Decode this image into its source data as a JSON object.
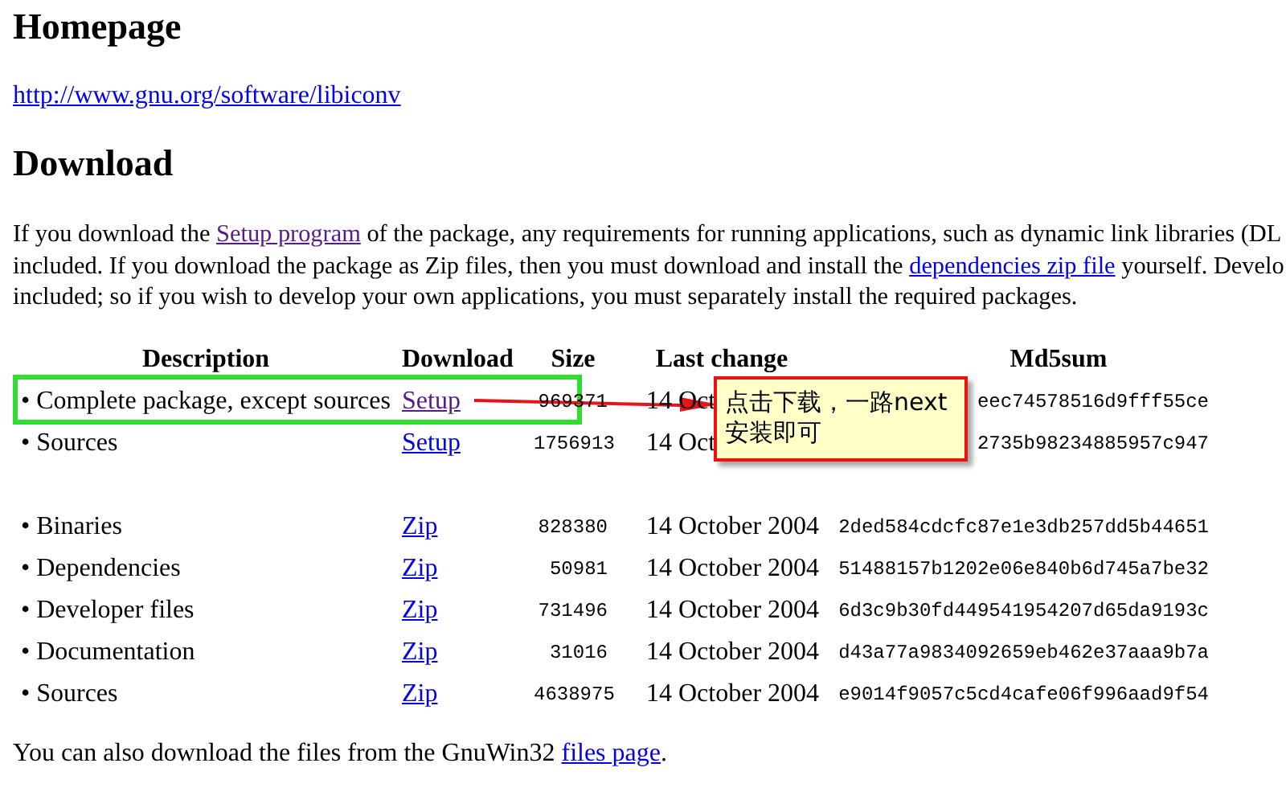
{
  "homepage": {
    "heading": "Homepage",
    "url": "http://www.gnu.org/software/libiconv"
  },
  "download": {
    "heading": "Download",
    "intro": [
      [
        {
          "kind": "text",
          "text": "If you download the "
        },
        {
          "kind": "link",
          "text": "Setup program",
          "visited": true
        },
        {
          "kind": "text",
          "text": " of the package, any requirements for running applications, such as dynamic link libraries (DL"
        }
      ],
      [
        {
          "kind": "text",
          "text": "included. If you download the package as Zip files, then you must download and install the "
        },
        {
          "kind": "link",
          "text": "dependencies zip file",
          "visited": false
        },
        {
          "kind": "text",
          "text": " yourself. Develo"
        }
      ],
      [
        {
          "kind": "text",
          "text": "included; so if you wish to develop your own applications, you must separately install the required packages."
        }
      ]
    ],
    "table": {
      "columns": [
        "Description",
        "Download",
        "Size",
        "Last change",
        "Md5sum"
      ],
      "row_groups": [
        [
          {
            "description": "• Complete package, except sources",
            "link": {
              "text": "Setup",
              "visited": true
            },
            "size": "969371",
            "last_change": "14 Oct",
            "md5sum": "eec74578516d9fff55ce"
          },
          {
            "description": "• Sources",
            "link": {
              "text": "Setup",
              "visited": false
            },
            "size": "1756913",
            "last_change": "14 Oct",
            "md5sum": "2735b98234885957c947"
          }
        ],
        [
          {
            "description": "• Binaries",
            "link": {
              "text": "Zip",
              "visited": false
            },
            "size": "828380",
            "last_change": "14 October 2004",
            "md5sum": "2ded584cdcfc87e1e3db257dd5b44651"
          },
          {
            "description": "• Dependencies",
            "link": {
              "text": "Zip",
              "visited": false
            },
            "size": "50981",
            "last_change": "14 October 2004",
            "md5sum": "51488157b1202e06e840b6d745a7be32"
          },
          {
            "description": "• Developer files",
            "link": {
              "text": "Zip",
              "visited": false
            },
            "size": "731496",
            "last_change": "14 October 2004",
            "md5sum": "6d3c9b30fd449541954207d65da9193c"
          },
          {
            "description": "• Documentation",
            "link": {
              "text": "Zip",
              "visited": false
            },
            "size": "31016",
            "last_change": "14 October 2004",
            "md5sum": "d43a77a9834092659eb462e37aaa9b7a"
          },
          {
            "description": "• Sources",
            "link": {
              "text": "Zip",
              "visited": false
            },
            "size": "4638975",
            "last_change": "14 October 2004",
            "md5sum": "e9014f9057c5cd4cafe06f996aad9f54"
          }
        ]
      ]
    },
    "footer": [
      {
        "kind": "text",
        "text": "You can also download the files from the GnuWin32 "
      },
      {
        "kind": "link",
        "text": "files page",
        "visited": false
      },
      {
        "kind": "text",
        "text": "."
      }
    ]
  },
  "callout": {
    "lines": [
      "点击下载，一路next",
      "安装即可"
    ]
  }
}
